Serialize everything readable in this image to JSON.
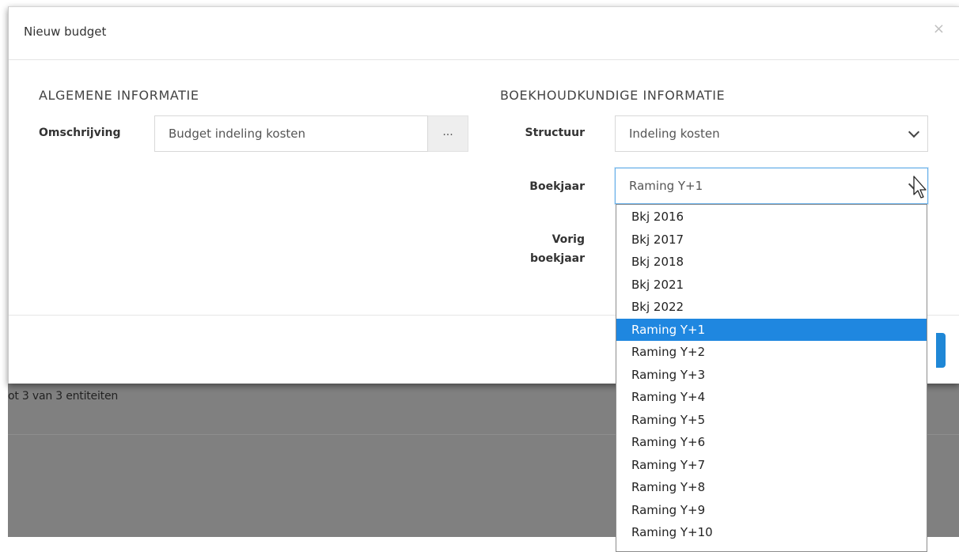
{
  "modal": {
    "title": "Nieuw budget"
  },
  "general": {
    "section_title": "ALGEMENE INFORMATIE",
    "description_label": "Omschrijving",
    "description_value": "Budget indeling kosten",
    "ellipsis_label": "..."
  },
  "accounting": {
    "section_title": "BOEKHOUDKUNDIGE INFORMATIE",
    "structure_label": "Structuur",
    "structure_value": "Indeling kosten",
    "fiscal_year_label": "Boekjaar",
    "fiscal_year_value": "Raming Y+1",
    "previous_year_label_line1": "Vorig",
    "previous_year_label_line2": "boekjaar"
  },
  "dropdown": {
    "options": [
      "Bkj 2016",
      "Bkj 2017",
      "Bkj 2018",
      "Bkj 2021",
      "Bkj 2022",
      "Raming Y+1",
      "Raming Y+2",
      "Raming Y+3",
      "Raming Y+4",
      "Raming Y+5",
      "Raming Y+6",
      "Raming Y+7",
      "Raming Y+8",
      "Raming Y+9",
      "Raming Y+10"
    ],
    "selected_index": 5
  },
  "background": {
    "entity_count_text": "ot 3 van 3 entiteiten"
  },
  "colors": {
    "accent": "#1f87e0",
    "overlay": "#808080"
  }
}
